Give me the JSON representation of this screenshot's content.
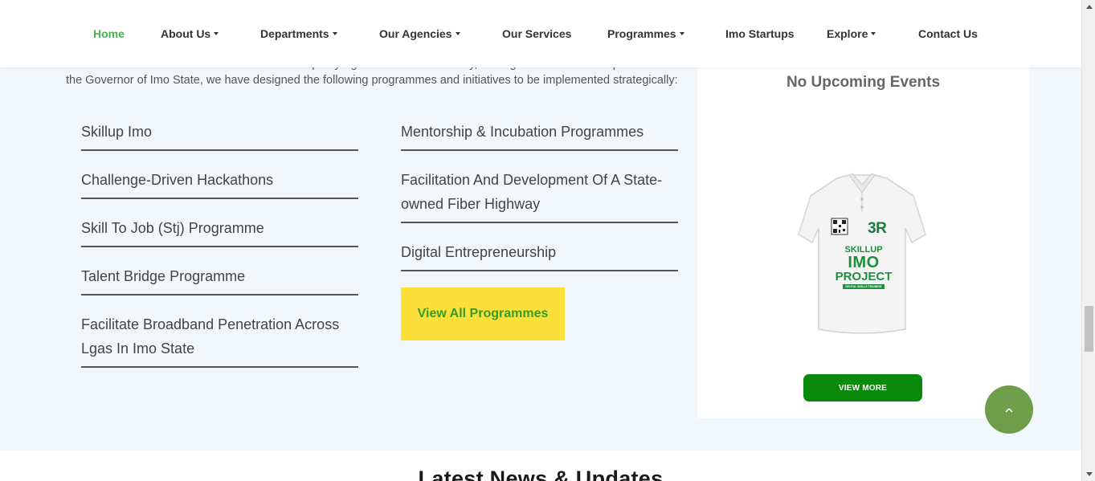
{
  "nav": {
    "home": "Home",
    "about": "About Us",
    "departments": "Departments",
    "agencies": "Our Agencies",
    "services": "Our Services",
    "programmes": "Programmes",
    "startups": "Imo Startups",
    "explore": "Explore",
    "contact": "Contact Us",
    "active_color": "#4caf50"
  },
  "intro": {
    "text": "To facilitate the actualization of the Shared Prosperity Agenda of His Excellency, Distinguished Senator Hope Uzodinma the Governor of Imo State, we have designed the following programmes and initiatives to be implemented strategically:"
  },
  "programmes": {
    "left": [
      "Skillup Imo",
      "Challenge-Driven Hackathons",
      "Skill To Job (Stj) Programme",
      "Talent Bridge Programme",
      "Facilitate Broadband Penetration Across Lgas In Imo State"
    ],
    "right": [
      "Mentorship & Incubation Programmes",
      "Facilitation And Development Of A State-owned Fiber Highway",
      "Digital Entrepreneurship"
    ],
    "view_all": "View All Programmes"
  },
  "events": {
    "title": "No Upcoming Events",
    "shirt": {
      "brand_3r": "3R",
      "line1": "SKILLUP",
      "line2": "IMO",
      "line3": "PROJECT",
      "tag": "DIGITAL SKILLS TRAINING"
    },
    "view_more": "VIEW MORE"
  },
  "news": {
    "title": "Latest News & Updates"
  },
  "colors": {
    "yellow_button": "#fbe03a",
    "green_button": "#0a8a0a",
    "back_to_top": "#6f9e4a"
  },
  "icons": {
    "back_to_top": "chevron-up-icon",
    "caret": "caret-down-icon"
  }
}
